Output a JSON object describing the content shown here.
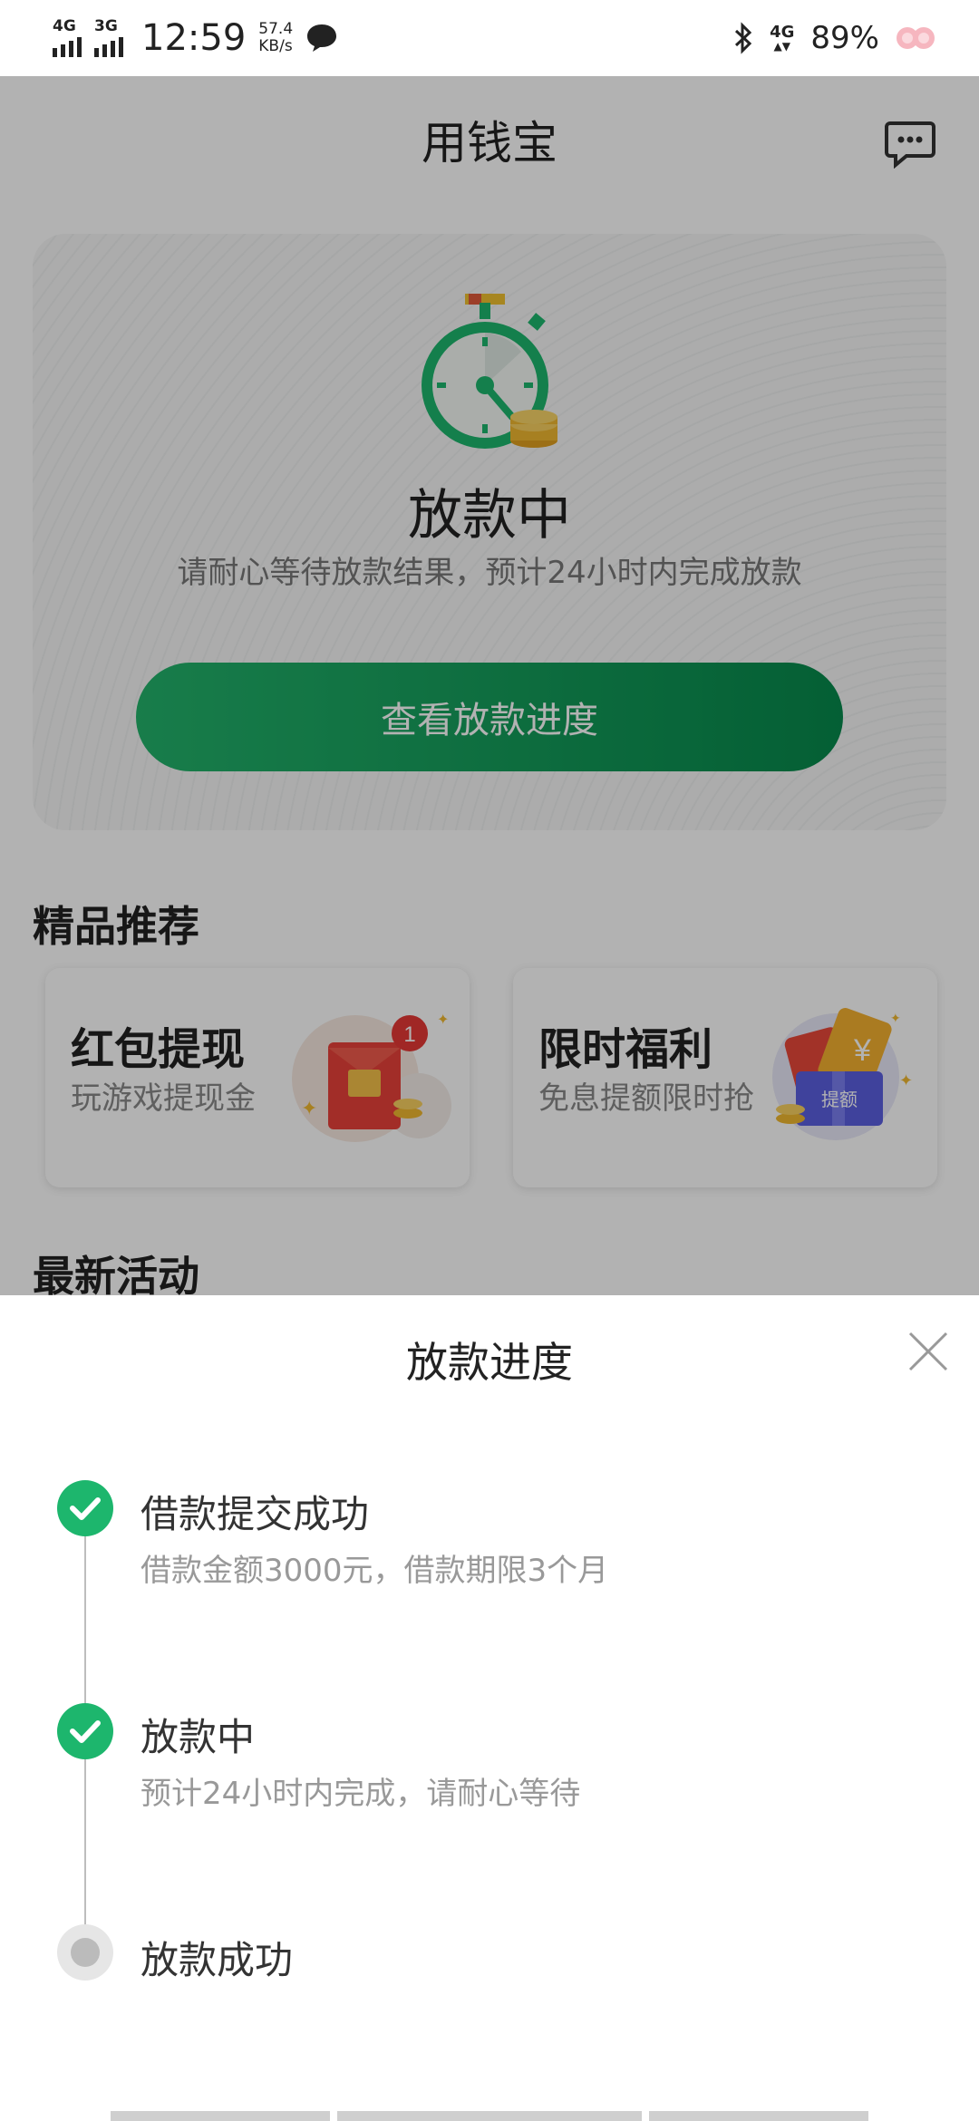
{
  "status_bar": {
    "network1": "4G",
    "network2": "3G",
    "time": "12:59",
    "speed_value": "57.4",
    "speed_unit": "KB/s",
    "network_right": "4G",
    "battery": "89%"
  },
  "header": {
    "title": "用钱宝",
    "chat_icon": "chat-bubble-icon"
  },
  "status_card": {
    "illustration": "stopwatch-coins-illustration",
    "title": "放款中",
    "description": "请耐心等待放款结果，预计24小时内完成放款",
    "button_label": "查看放款进度"
  },
  "recommend": {
    "section_title": "精品推荐",
    "items": [
      {
        "title": "红包提现",
        "subtitle": "玩游戏提现金",
        "badge": "1",
        "icon": "red-envelope-icon"
      },
      {
        "title": "限时福利",
        "subtitle": "免息提额限时抢",
        "tag": "提额",
        "icon": "coupon-gift-icon"
      }
    ]
  },
  "activity": {
    "section_title": "最新活动"
  },
  "sheet": {
    "title": "放款进度",
    "close_icon": "close-icon",
    "steps": [
      {
        "title": "借款提交成功",
        "desc": "借款金额3000元，借款期限3个月",
        "status": "done"
      },
      {
        "title": "放款中",
        "desc": "预计24小时内完成，请耐心等待",
        "status": "done"
      },
      {
        "title": "放款成功",
        "desc": "",
        "status": "pending"
      }
    ]
  },
  "colors": {
    "accent": "#1db66d",
    "button_start": "#23b36b",
    "button_end": "#07894c",
    "badge": "#e53935"
  }
}
